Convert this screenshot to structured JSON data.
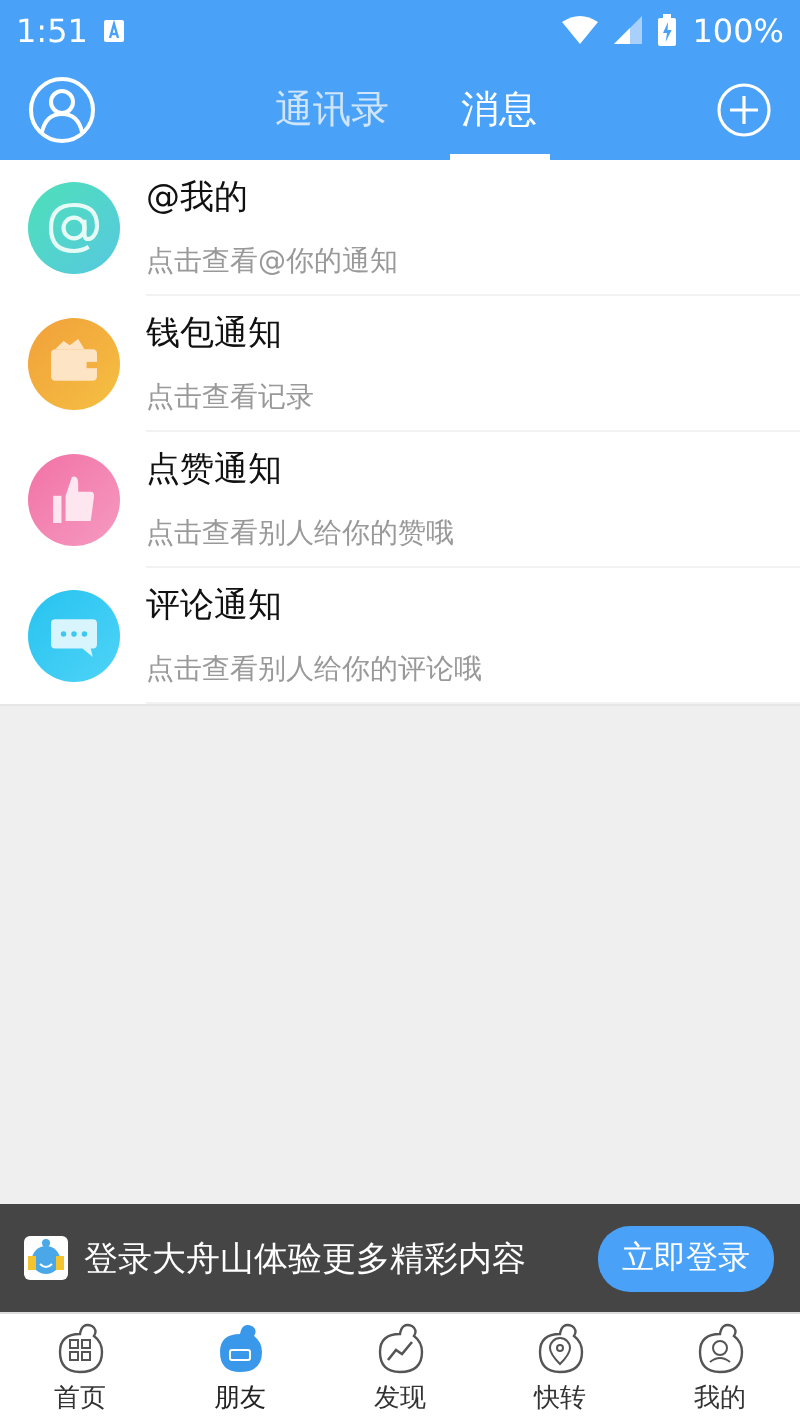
{
  "status_bar": {
    "time": "1:51",
    "battery": "100%"
  },
  "header": {
    "tabs": [
      {
        "label": "通讯录",
        "selected": false
      },
      {
        "label": "消息",
        "selected": true
      }
    ]
  },
  "messages": [
    {
      "kind": "at",
      "title": "@我的",
      "subtitle": "点击查看@你的通知"
    },
    {
      "kind": "wallet",
      "title": "钱包通知",
      "subtitle": "点击查看记录"
    },
    {
      "kind": "like",
      "title": "点赞通知",
      "subtitle": "点击查看别人给你的赞哦"
    },
    {
      "kind": "comment",
      "title": "评论通知",
      "subtitle": "点击查看别人给你的评论哦"
    }
  ],
  "login_banner": {
    "text": "登录大舟山体验更多精彩内容",
    "button": "立即登录"
  },
  "bottom_nav": [
    {
      "kind": "home",
      "label": "首页",
      "selected": false
    },
    {
      "kind": "friends",
      "label": "朋友",
      "selected": true
    },
    {
      "kind": "discover",
      "label": "发现",
      "selected": false
    },
    {
      "kind": "location",
      "label": "快转",
      "selected": false
    },
    {
      "kind": "me",
      "label": "我的",
      "selected": false
    }
  ]
}
